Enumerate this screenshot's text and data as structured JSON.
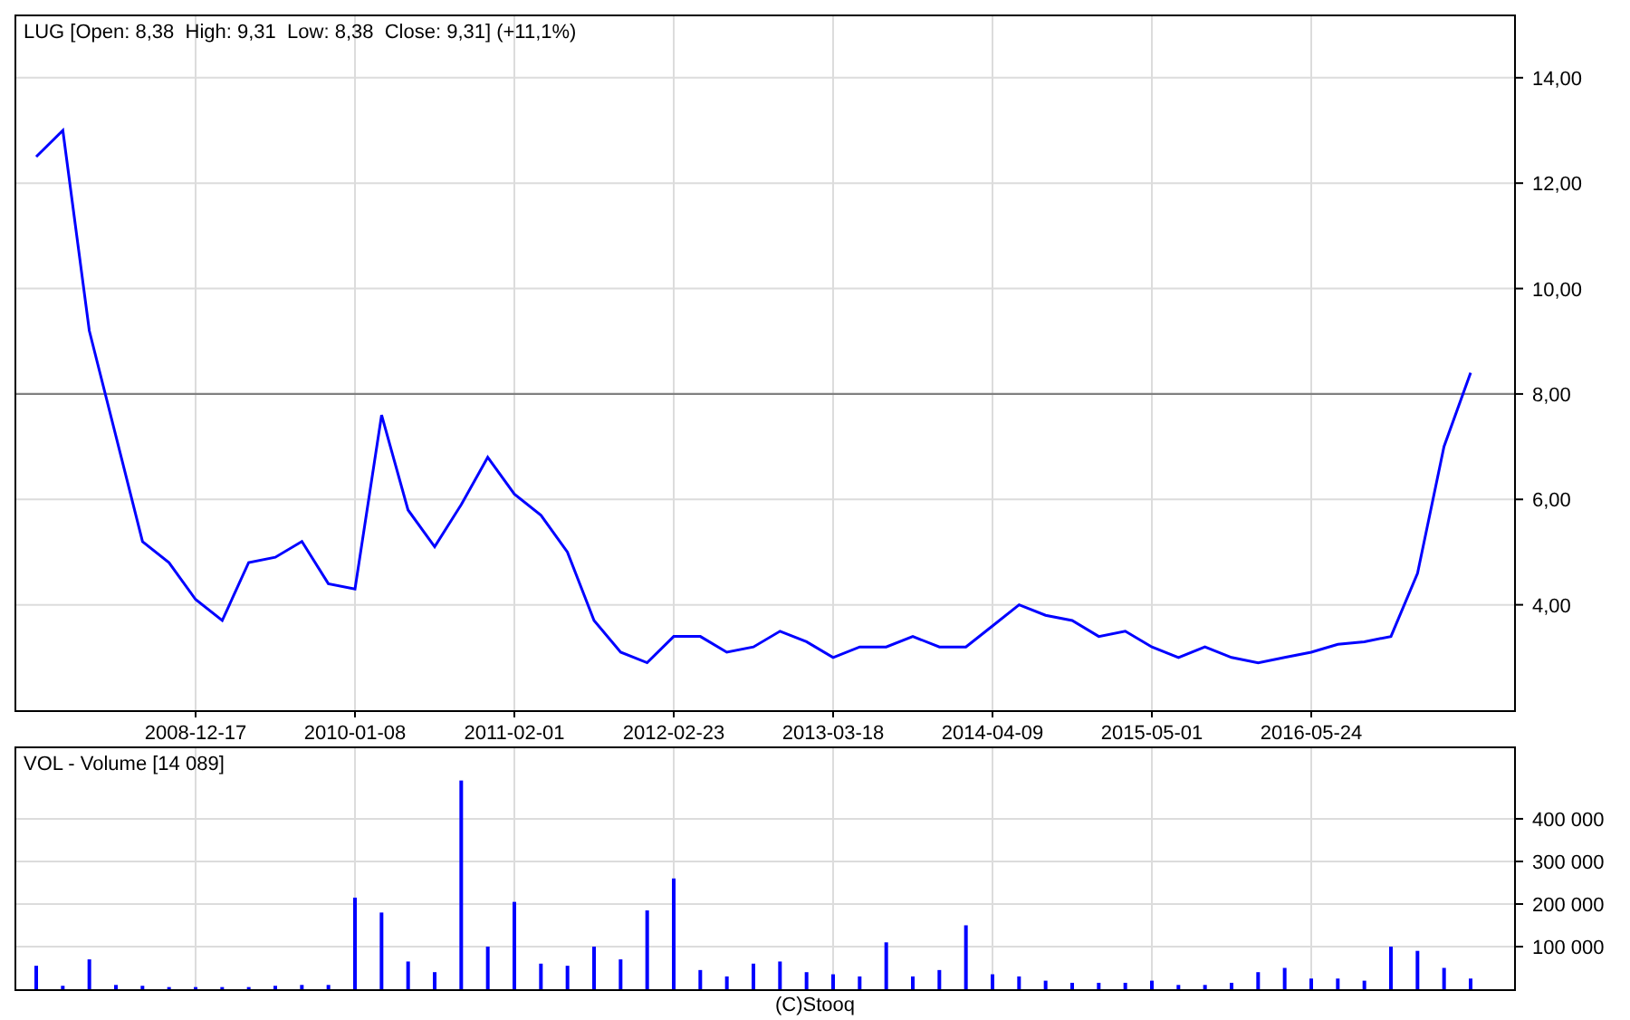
{
  "price_panel": {
    "chart_data": {
      "type": "line",
      "title": "LUG [Open: 8,38  High: 9,31  Low: 8,38  Close: 9,31] (+11,1%)",
      "categories": [
        null,
        null,
        null,
        null,
        null,
        null,
        "2008-12-17",
        null,
        null,
        null,
        null,
        null,
        "2010-01-08",
        null,
        null,
        null,
        null,
        null,
        "2011-02-01",
        null,
        null,
        null,
        null,
        null,
        "2012-02-23",
        null,
        null,
        null,
        null,
        null,
        "2013-03-18",
        null,
        null,
        null,
        null,
        null,
        "2014-04-09",
        null,
        null,
        null,
        null,
        null,
        "2015-05-01",
        null,
        null,
        null,
        null,
        null,
        "2016-05-24",
        null,
        null,
        null,
        null,
        null,
        null
      ],
      "series": [
        {
          "color": "#0000ff",
          "values": [
            12.5,
            13.0,
            9.2,
            7.2,
            5.2,
            4.8,
            4.1,
            3.7,
            4.8,
            4.9,
            5.2,
            4.4,
            4.3,
            7.6,
            5.8,
            5.1,
            5.9,
            6.8,
            6.1,
            5.7,
            5.0,
            3.7,
            3.1,
            2.9,
            3.4,
            3.4,
            3.1,
            3.2,
            3.5,
            3.3,
            3.0,
            3.2,
            3.2,
            3.4,
            3.2,
            3.2,
            3.6,
            4.0,
            3.8,
            3.7,
            3.4,
            3.5,
            3.2,
            3.0,
            3.2,
            3.0,
            2.9,
            3.0,
            3.1,
            3.25,
            3.3,
            3.4,
            4.6,
            7.0,
            8.4
          ]
        }
      ],
      "ylim": [
        2.0,
        15.2
      ],
      "yticks": [
        {
          "value": 4,
          "label": "4,00"
        },
        {
          "value": 6,
          "label": "6,00"
        },
        {
          "value": 8,
          "label": "8,00"
        },
        {
          "value": 10,
          "label": "10,00"
        },
        {
          "value": 12,
          "label": "12,00"
        },
        {
          "value": 14,
          "label": "14,00"
        }
      ],
      "ref_lines": [
        {
          "axis": "y",
          "value": 8
        }
      ],
      "grid": true
    }
  },
  "volume_panel": {
    "chart_data": {
      "type": "bar",
      "title": "VOL - Volume [14 089]",
      "categories": [
        null,
        null,
        null,
        null,
        null,
        null,
        null,
        null,
        null,
        null,
        null,
        null,
        null,
        null,
        null,
        null,
        null,
        null,
        null,
        null,
        null,
        null,
        null,
        null,
        null,
        null,
        null,
        null,
        null,
        null,
        null,
        null,
        null,
        null,
        null,
        null,
        null,
        null,
        null,
        null,
        null,
        null,
        null,
        null,
        null,
        null,
        null,
        null,
        null,
        null,
        null,
        null,
        null,
        null,
        null
      ],
      "series": [
        {
          "color": "#0000ff",
          "values": [
            55000,
            8000,
            70000,
            10000,
            8000,
            5000,
            5000,
            5000,
            5000,
            8000,
            10000,
            10000,
            215000,
            180000,
            65000,
            40000,
            490000,
            100000,
            205000,
            60000,
            55000,
            100000,
            70000,
            185000,
            260000,
            45000,
            30000,
            60000,
            65000,
            40000,
            35000,
            30000,
            110000,
            30000,
            45000,
            150000,
            35000,
            30000,
            20000,
            15000,
            15000,
            15000,
            20000,
            10000,
            10000,
            15000,
            40000,
            50000,
            25000,
            25000,
            20000,
            100000,
            90000,
            50000,
            25000
          ]
        }
      ],
      "ylim": [
        0,
        570000
      ],
      "yticks": [
        {
          "value": 100000,
          "label": "100 000"
        },
        {
          "value": 200000,
          "label": "200 000"
        },
        {
          "value": 300000,
          "label": "300 000"
        },
        {
          "value": 400000,
          "label": "400 000"
        }
      ],
      "grid": true
    }
  },
  "footer": {
    "copyright": "(C)Stooq"
  }
}
